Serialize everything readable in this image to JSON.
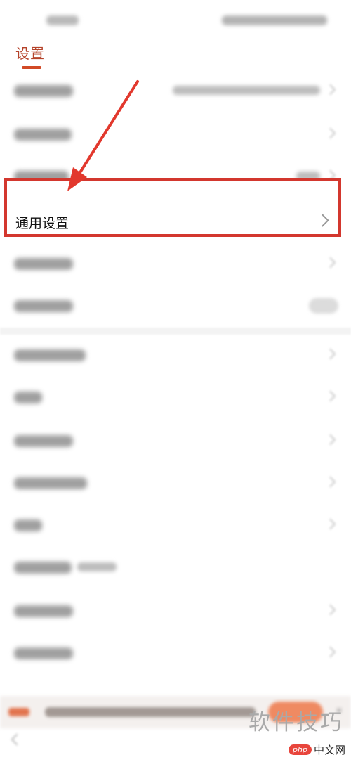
{
  "header": {
    "title": "设置"
  },
  "settings": {
    "highlighted_item": "通用设置"
  },
  "watermark": {
    "cn_text": "软件技巧",
    "badge": "php",
    "site_text": "中文网"
  },
  "colors": {
    "accent": "#d24a26",
    "highlight_border": "#d3372e",
    "arrow": "#e2382d"
  }
}
